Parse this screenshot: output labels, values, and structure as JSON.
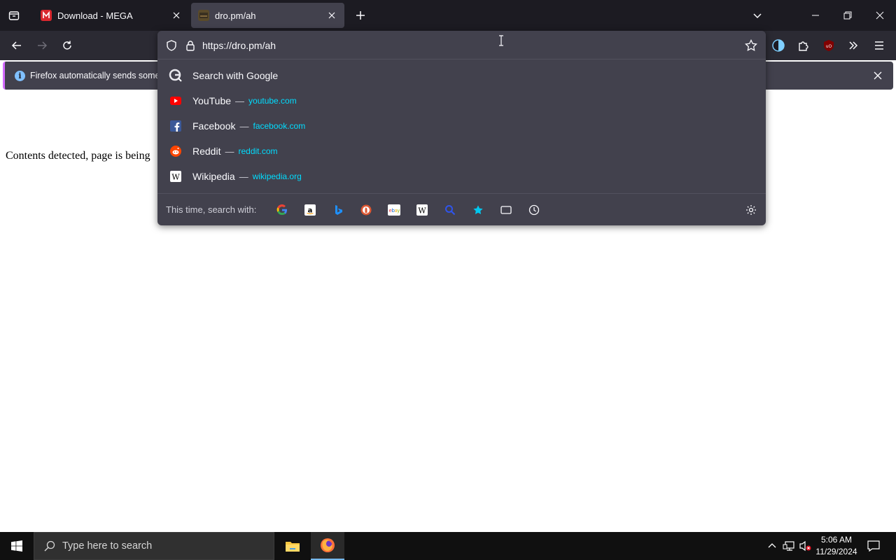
{
  "browser": {
    "tabs": [
      {
        "title": "Download - MEGA",
        "favicon": "mega-icon",
        "active": false
      },
      {
        "title": "dro.pm/ah",
        "favicon": "site-favicon",
        "active": true
      }
    ]
  },
  "urlbar": {
    "value": "https://dro.pm/ah",
    "suggestions": [
      {
        "title": "Search with Google",
        "url": "",
        "icon": "google-search-icon"
      },
      {
        "title": "YouTube",
        "url": "youtube.com",
        "icon": "youtube-icon"
      },
      {
        "title": "Facebook",
        "url": "facebook.com",
        "icon": "facebook-icon"
      },
      {
        "title": "Reddit",
        "url": "reddit.com",
        "icon": "reddit-icon"
      },
      {
        "title": "Wikipedia",
        "url": "wikipedia.org",
        "icon": "wikipedia-icon"
      }
    ],
    "dash": "—",
    "oneoff_label": "This time, search with:",
    "oneoff_engines": [
      "google",
      "amazon",
      "bing",
      "duckduckgo",
      "ebay",
      "wikipedia",
      "search",
      "bookmarks",
      "tabs",
      "history"
    ]
  },
  "notification": {
    "message": "Firefox automatically sends some d"
  },
  "page": {
    "text": "Contents detected, page is being"
  },
  "taskbar": {
    "search_placeholder": "Type here to search",
    "time": "5:06 AM",
    "date": "11/29/2024"
  },
  "colors": {
    "tabstrip": "#1c1b22",
    "toolbar": "#2b2a33",
    "panel": "#42414d",
    "url_accent": "#00ddff"
  }
}
